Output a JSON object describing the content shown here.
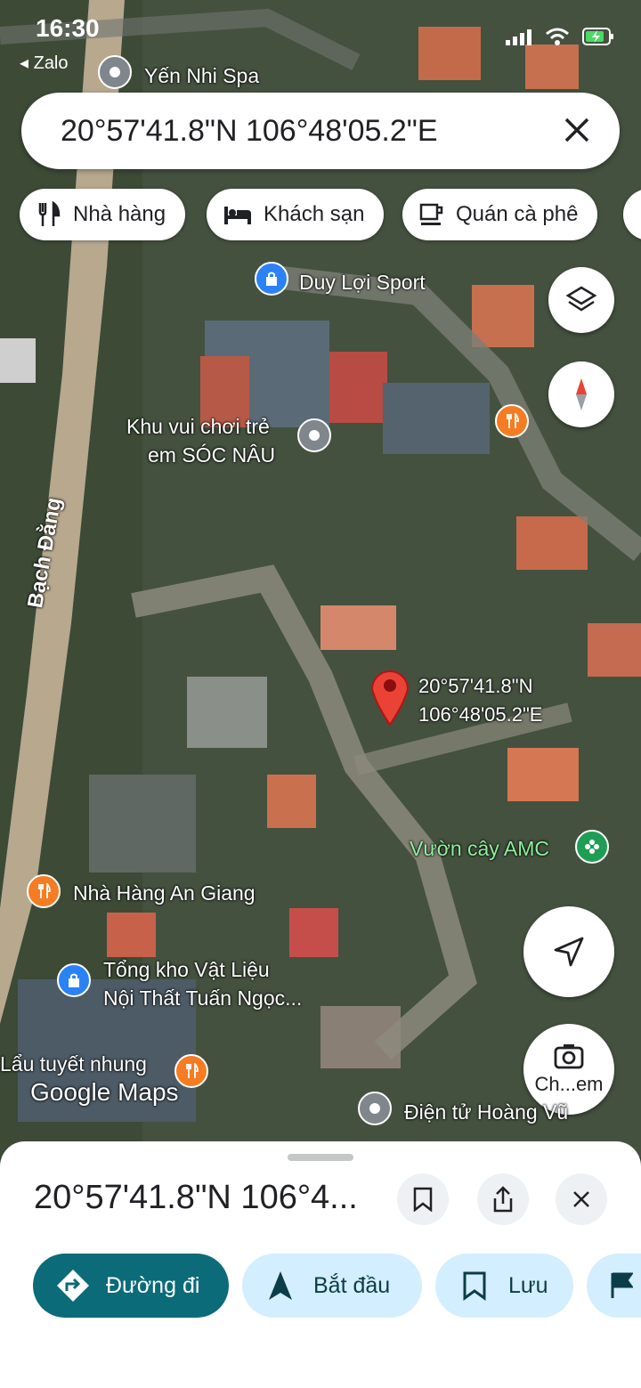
{
  "status_bar": {
    "time": "16:30",
    "back_app": "◂ Zalo"
  },
  "search": {
    "query": "20°57'41.8\"N 106°48'05.2\"E"
  },
  "chips": [
    {
      "label": "Nhà hàng",
      "icon": "restaurant-icon"
    },
    {
      "label": "Khách sạn",
      "icon": "hotel-icon"
    },
    {
      "label": "Quán cà phê",
      "icon": "coffee-icon"
    }
  ],
  "map": {
    "street_label": "Bạch Đằng",
    "pin_label_line1": "20°57'41.8\"N",
    "pin_label_line2": "106°48'05.2\"E",
    "watermark": "Google Maps",
    "places": {
      "yen_nhi_spa": "Yến Nhi Spa",
      "duy_loi_sport": "Duy Lợi Sport",
      "soc_nau_line1": "Khu vui chơi trẻ",
      "soc_nau_line2": "em SÓC NÂU",
      "vuon_cay": "Vườn cây AMC",
      "an_giang": "Nhà Hàng An Giang",
      "tuan_ngoc_line1": "Tổng kho Vật Liệu",
      "tuan_ngoc_line2": "Nội Thất Tuấn Ngọc...",
      "lau": "Lẩu tuyết nhung",
      "dien_tu": "Điện tử Hoàng Vũ"
    },
    "camera_button_label": "Ch...em"
  },
  "sheet": {
    "title": "20°57'41.8\"N 106°4...",
    "actions": [
      {
        "label": "Đường đi",
        "icon": "directions-icon"
      },
      {
        "label": "Bắt đầu",
        "icon": "navigation-arrow-icon"
      },
      {
        "label": "Lưu",
        "icon": "bookmark-icon"
      }
    ]
  },
  "colors": {
    "accent": "#0b6b79",
    "pin": "#ea4335",
    "chip_pill": "#d3eefe",
    "poi_orange": "#f57c22",
    "poi_blue": "#2b82f6",
    "poi_green": "#1e9e55",
    "poi_gray": "#7f868c"
  }
}
